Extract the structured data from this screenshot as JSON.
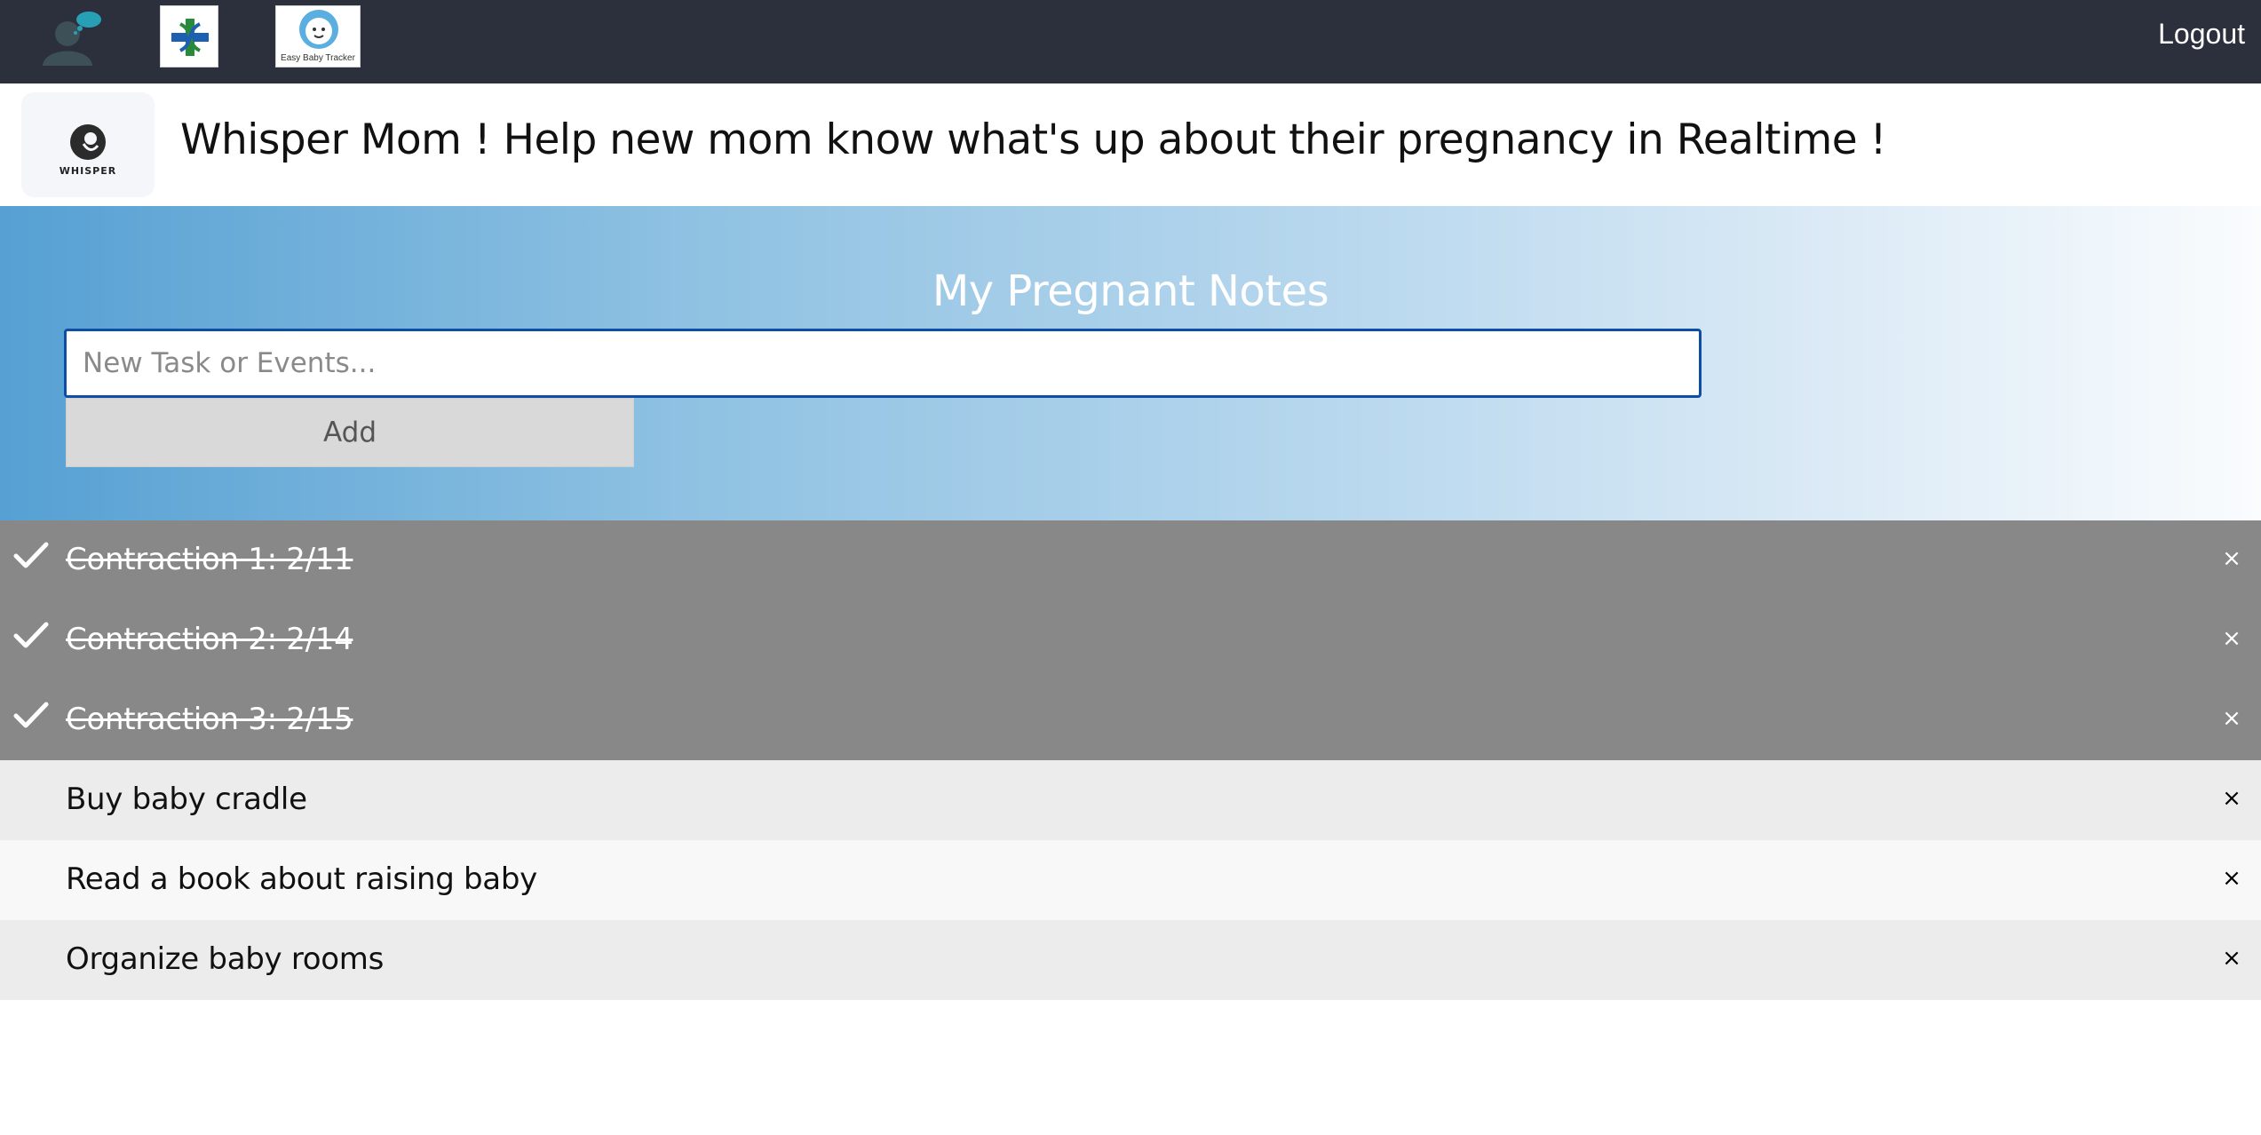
{
  "navbar": {
    "logout_label": "Logout",
    "baby_tracker_caption": "Easy Baby Tracker",
    "colors": {
      "background": "#2b303c",
      "avatar": "#3d4f57",
      "bubble": "#27a0b6"
    }
  },
  "header": {
    "logo_word": "WHISPER",
    "title": "Whisper Mom ! Help new mom know what's up about their pregnancy in Realtime !"
  },
  "hero": {
    "title": "My Pregnant Notes",
    "input_placeholder": "New Task or Events...",
    "input_value": "",
    "add_label": "Add",
    "accent_color": "#56a0d3"
  },
  "tasks": [
    {
      "text": "Contraction 1: 2/11",
      "checked": true,
      "close_label": "×"
    },
    {
      "text": "Contraction 2: 2/14",
      "checked": true,
      "close_label": "×"
    },
    {
      "text": "Contraction 3: 2/15",
      "checked": true,
      "close_label": "×"
    },
    {
      "text": "Buy baby cradle",
      "checked": false,
      "close_label": "×"
    },
    {
      "text": "Read a book about raising baby",
      "checked": false,
      "close_label": "×"
    },
    {
      "text": "Organize baby rooms",
      "checked": false,
      "close_label": "×"
    }
  ]
}
